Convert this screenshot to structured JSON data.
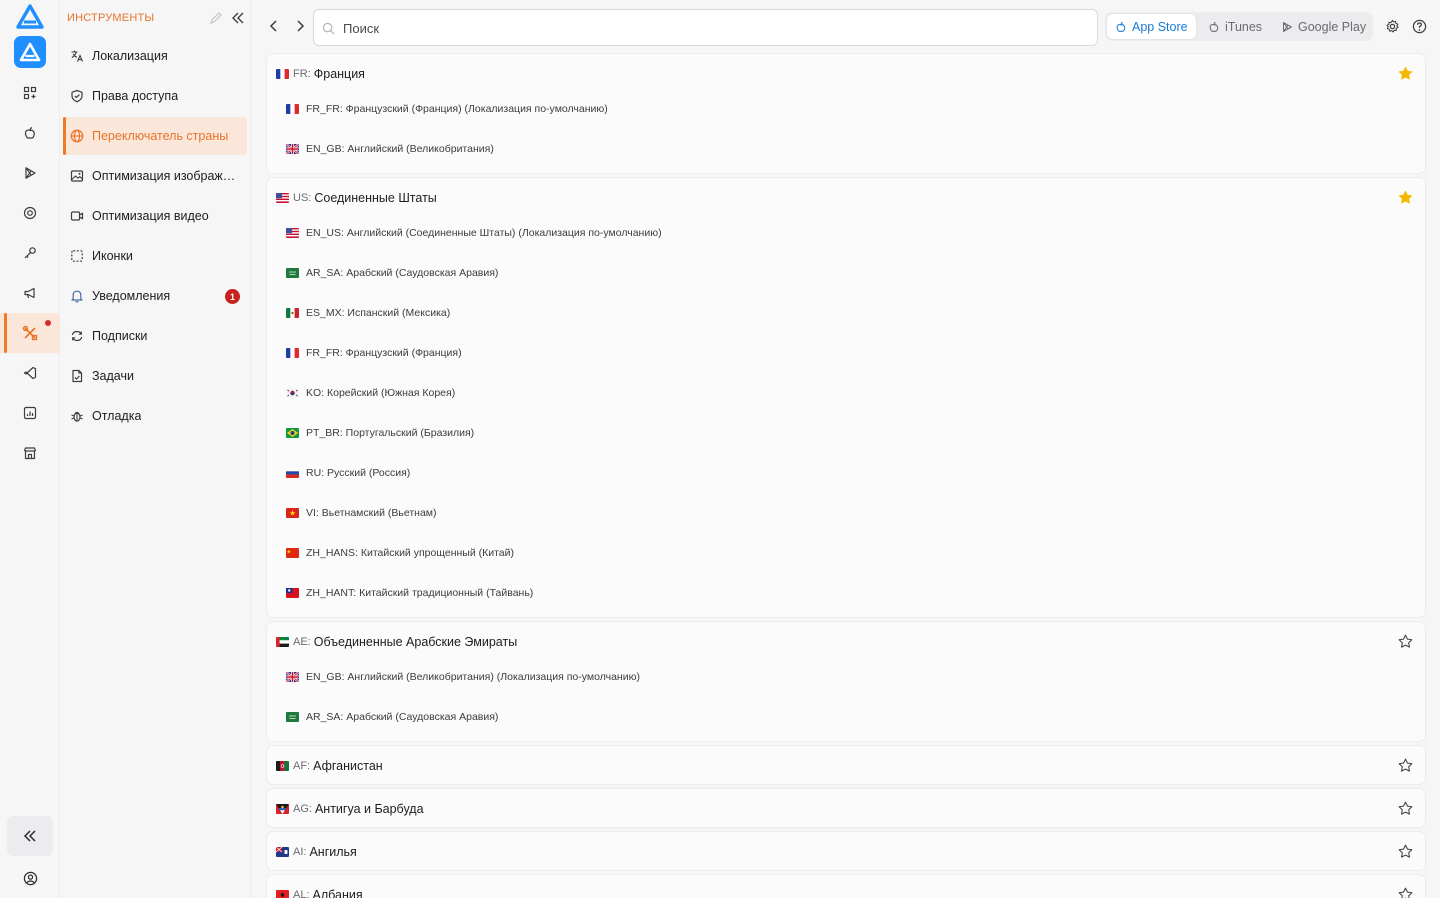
{
  "sidebar": {
    "items": [
      {
        "name": "apps-icon"
      },
      {
        "name": "apple-icon"
      },
      {
        "name": "google-play-icon"
      },
      {
        "name": "target-icon"
      },
      {
        "name": "key-icon"
      },
      {
        "name": "megaphone-icon"
      },
      {
        "name": "tools-icon",
        "active": true,
        "has_dot": true
      },
      {
        "name": "vscode-icon"
      },
      {
        "name": "chart-icon"
      },
      {
        "name": "store-icon"
      }
    ]
  },
  "tools": {
    "title": "ИНСТРУМЕНТЫ",
    "items": [
      {
        "label": "Локализация",
        "icon": "translate-icon"
      },
      {
        "label": "Права доступа",
        "icon": "shield-icon"
      },
      {
        "label": "Переключатель страны",
        "icon": "globe-icon",
        "active": true
      },
      {
        "label": "Оптимизация изображений",
        "icon": "image-icon"
      },
      {
        "label": "Оптимизация видео",
        "icon": "video-icon"
      },
      {
        "label": "Иконки",
        "icon": "icons-icon"
      },
      {
        "label": "Уведомления",
        "icon": "bell-icon",
        "badge": "1"
      },
      {
        "label": "Подписки",
        "icon": "refresh-icon"
      },
      {
        "label": "Задачи",
        "icon": "task-icon"
      },
      {
        "label": "Отладка",
        "icon": "bug-icon"
      }
    ]
  },
  "search": {
    "placeholder": "Поиск",
    "value": ""
  },
  "stores": [
    {
      "label": "App Store",
      "icon": "apple-icon",
      "active": true
    },
    {
      "label": "iTunes",
      "icon": "apple-icon"
    },
    {
      "label": "Google Play",
      "icon": "google-play-icon"
    }
  ],
  "countries": [
    {
      "code": "FR:",
      "name": "Франция",
      "flag": "fr",
      "starred": true,
      "locales": [
        {
          "flag": "fr",
          "text": "FR_FR: Французский (Франция) (Локализация по-умолчанию)"
        },
        {
          "flag": "gb",
          "text": "EN_GB: Английский (Великобритания)"
        }
      ]
    },
    {
      "code": "US:",
      "name": "Соединенные Штаты",
      "flag": "us",
      "starred": true,
      "locales": [
        {
          "flag": "us",
          "text": "EN_US: Английский (Соединенные Штаты) (Локализация по-умолчанию)"
        },
        {
          "flag": "sa",
          "text": "AR_SA: Арабский (Саудовская Аравия)"
        },
        {
          "flag": "mx",
          "text": "ES_MX: Испанский (Мексика)"
        },
        {
          "flag": "fr",
          "text": "FR_FR: Французский (Франция)"
        },
        {
          "flag": "kr",
          "text": "KO: Корейский (Южная Корея)"
        },
        {
          "flag": "br",
          "text": "PT_BR: Португальский (Бразилия)"
        },
        {
          "flag": "ru",
          "text": "RU: Русский (Россия)"
        },
        {
          "flag": "vn",
          "text": "VI: Вьетнамский (Вьетнам)"
        },
        {
          "flag": "cn",
          "text": "ZH_HANS: Китайский упрощенный (Китай)"
        },
        {
          "flag": "tw",
          "text": "ZH_HANT: Китайский традиционный (Тайвань)"
        }
      ]
    },
    {
      "code": "AE:",
      "name": "Объединенные Арабские Эмираты",
      "flag": "ae",
      "starred": false,
      "locales": [
        {
          "flag": "gb",
          "text": "EN_GB: Английский (Великобритания) (Локализация по-умолчанию)"
        },
        {
          "flag": "sa",
          "text": "AR_SA: Арабский (Саудовская Аравия)"
        }
      ]
    },
    {
      "code": "AF:",
      "name": "Афганистан",
      "flag": "af",
      "starred": false,
      "locales": []
    },
    {
      "code": "AG:",
      "name": "Антигуа и Барбуда",
      "flag": "ag",
      "starred": false,
      "locales": []
    },
    {
      "code": "AI:",
      "name": "Ангилья",
      "flag": "ai",
      "starred": false,
      "locales": []
    },
    {
      "code": "AL:",
      "name": "Албания",
      "flag": "al",
      "starred": false,
      "locales": []
    }
  ],
  "colors": {
    "accent": "#f07a2b",
    "star": "#f5b800",
    "link_blue": "#1a7bd6",
    "badge": "#c8221f"
  }
}
